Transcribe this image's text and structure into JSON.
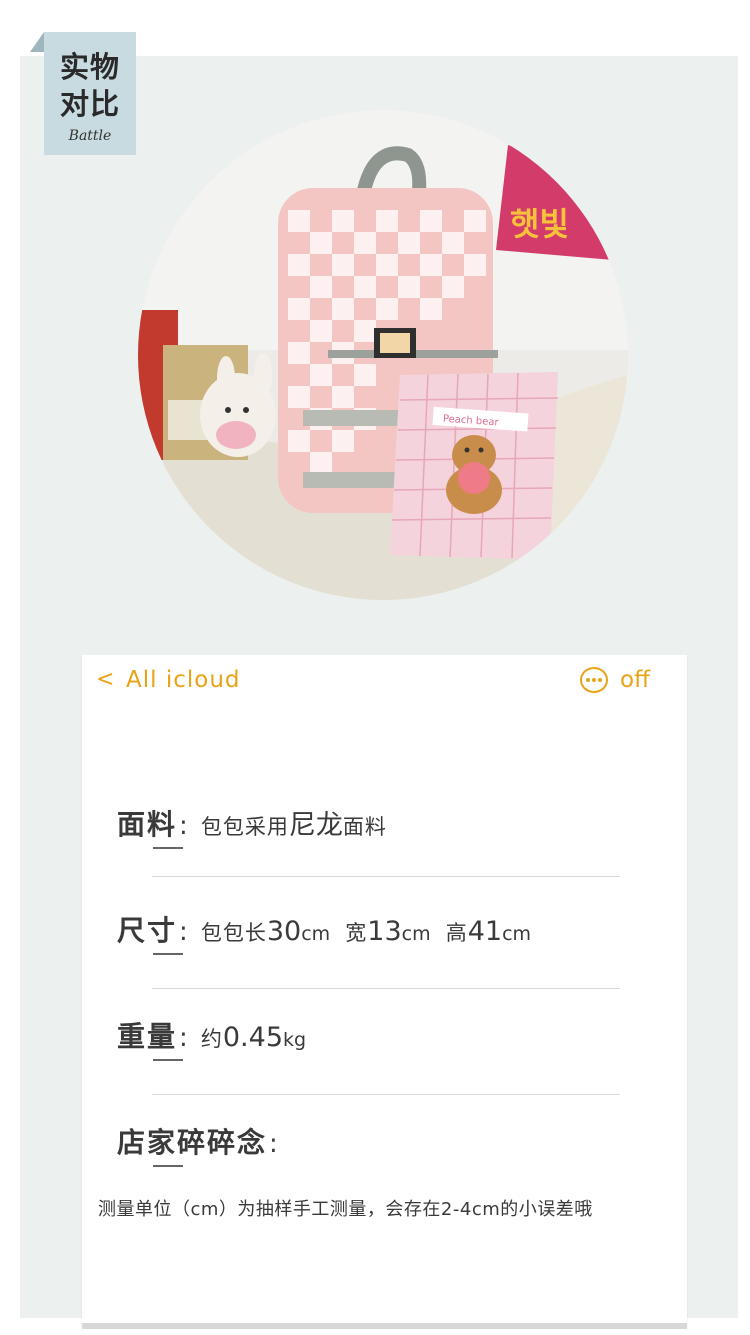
{
  "badge": {
    "line1": "实物",
    "line2": "对比",
    "sub": "Battle"
  },
  "photo": {
    "sign_text": "햇빛",
    "patch_text": "Peach bear"
  },
  "topbar": {
    "back_glyph": "<",
    "title": "All icloud",
    "more_icon": "ellipsis-circle-icon",
    "off_label": "off",
    "accent": "#e8a317"
  },
  "specs": {
    "fabric": {
      "label": "面料",
      "value_pre": "包包采用",
      "value_big": "尼龙",
      "value_post": "面料"
    },
    "size": {
      "label": "尺寸",
      "len_label": "包包长",
      "len_num": "30",
      "len_unit": "cm",
      "wid_label": "宽",
      "wid_num": "13",
      "wid_unit": "cm",
      "hgt_label": "高",
      "hgt_num": "41",
      "hgt_unit": "cm"
    },
    "weight": {
      "label": "重量",
      "prefix": "约",
      "num": "0.45",
      "unit": "kg"
    },
    "notes": {
      "label": "店家碎碎念"
    }
  },
  "note": "测量单位（cm）为抽样手工测量，会存在2-4cm的小误差哦"
}
